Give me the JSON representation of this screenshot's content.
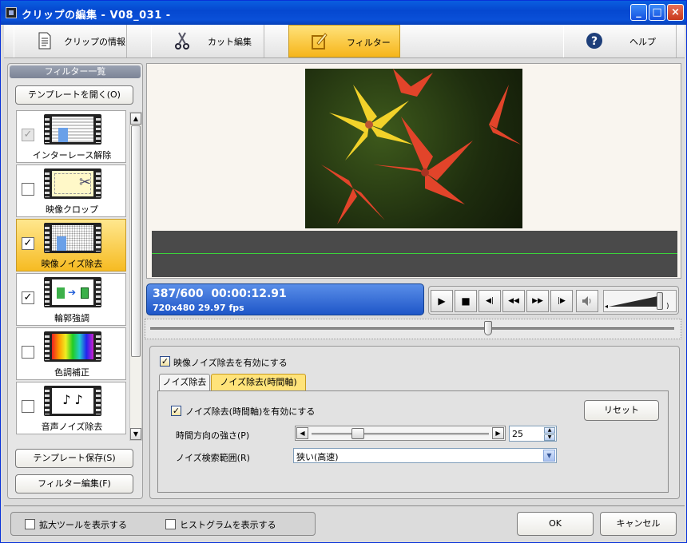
{
  "window": {
    "title": "クリップの編集 - V08_031 -",
    "minimize": "_",
    "maximize": "□",
    "close": "×"
  },
  "toolbar": {
    "tabs": [
      {
        "label": "クリップの情報",
        "icon": "document-icon"
      },
      {
        "label": "カット編集",
        "icon": "scissors-icon"
      },
      {
        "label": "フィルター",
        "icon": "filter-edit-icon",
        "active": true
      },
      {
        "label": "ヘルプ",
        "icon": "help-icon"
      }
    ]
  },
  "sidebar": {
    "title": "フィルター一覧",
    "open_template": "テンプレートを開く(O)",
    "items": [
      {
        "label": "インターレース解除",
        "checked": true,
        "disabled": true,
        "icon": "deinterlace-icon"
      },
      {
        "label": "映像クロップ",
        "checked": false,
        "icon": "crop-icon"
      },
      {
        "label": "映像ノイズ除去",
        "checked": true,
        "selected": true,
        "icon": "video-noise-icon"
      },
      {
        "label": "輪郭強調",
        "checked": true,
        "icon": "sharpen-icon"
      },
      {
        "label": "色調補正",
        "checked": false,
        "icon": "color-correction-icon"
      },
      {
        "label": "音声ノイズ除去",
        "checked": false,
        "icon": "audio-noise-icon"
      }
    ],
    "save_template": "テンプレート保存(S)",
    "edit_filter": "フィルター編集(F)"
  },
  "status": {
    "frame": "387/600",
    "timecode": "00:00:12.91",
    "format": "720x480 29.97 fps"
  },
  "transport": {
    "play": "▶",
    "stop": "■",
    "step_back": "◀|",
    "rewind": "◀◀",
    "forward": "▶▶",
    "step_fwd": "|▶",
    "volume": 0.85
  },
  "seek": {
    "position": 387,
    "total": 600
  },
  "settings": {
    "enable_filter_label": "映像ノイズ除去を有効にする",
    "enable_filter_checked": true,
    "tabs": [
      "ノイズ除去",
      "ノイズ除去(時間軸)"
    ],
    "active_tab": 1,
    "enable_temporal_label": "ノイズ除去(時間軸)を有効にする",
    "enable_temporal_checked": true,
    "reset": "リセット",
    "strength_label": "時間方向の強さ(P)",
    "strength_value": "25",
    "search_label": "ノイズ検索範囲(R)",
    "search_value": "狭い(高速)"
  },
  "footer": {
    "show_zoom": "拡大ツールを表示する",
    "show_histogram": "ヒストグラムを表示する",
    "ok": "OK",
    "cancel": "キャンセル"
  },
  "colors": {
    "accent": "#f6b51a",
    "titlebar": "#0548d0",
    "info": "#1e56c8"
  }
}
